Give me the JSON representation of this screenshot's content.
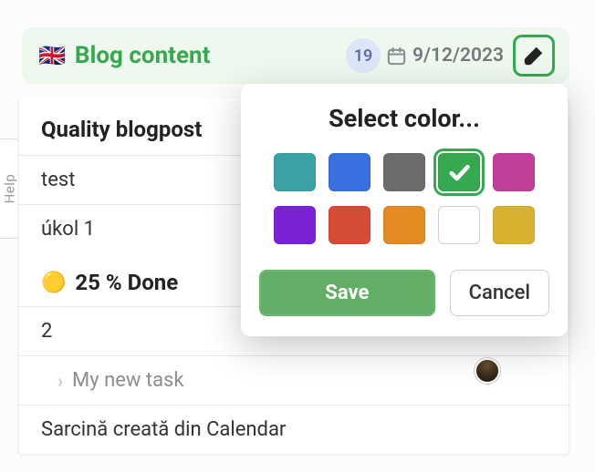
{
  "help": {
    "label": "Help"
  },
  "card": {
    "flag": "🇬🇧",
    "title": "Blog content",
    "count": "19",
    "date": "9/12/2023"
  },
  "list": {
    "section1_title": "Quality blogpost",
    "rows": [
      "test",
      "úkol 1"
    ],
    "progress_emoji": "🟡",
    "progress_label": "25 % Done",
    "rows2": [
      "2"
    ],
    "subtask": "My new task",
    "rows3": [
      "Sarcină creată din Calendar"
    ]
  },
  "popover": {
    "title": "Select color...",
    "save": "Save",
    "cancel": "Cancel",
    "colors": {
      "teal": "#3aa1a6",
      "blue": "#3a6fe0",
      "gray": "#6c6c6c",
      "green": "#36a84f",
      "magenta": "#c13f9a",
      "purple": "#7b22d6",
      "red": "#d64a38",
      "orange": "#e38a22",
      "white": "#ffffff",
      "gold": "#d6b22f"
    },
    "selected": "green"
  }
}
